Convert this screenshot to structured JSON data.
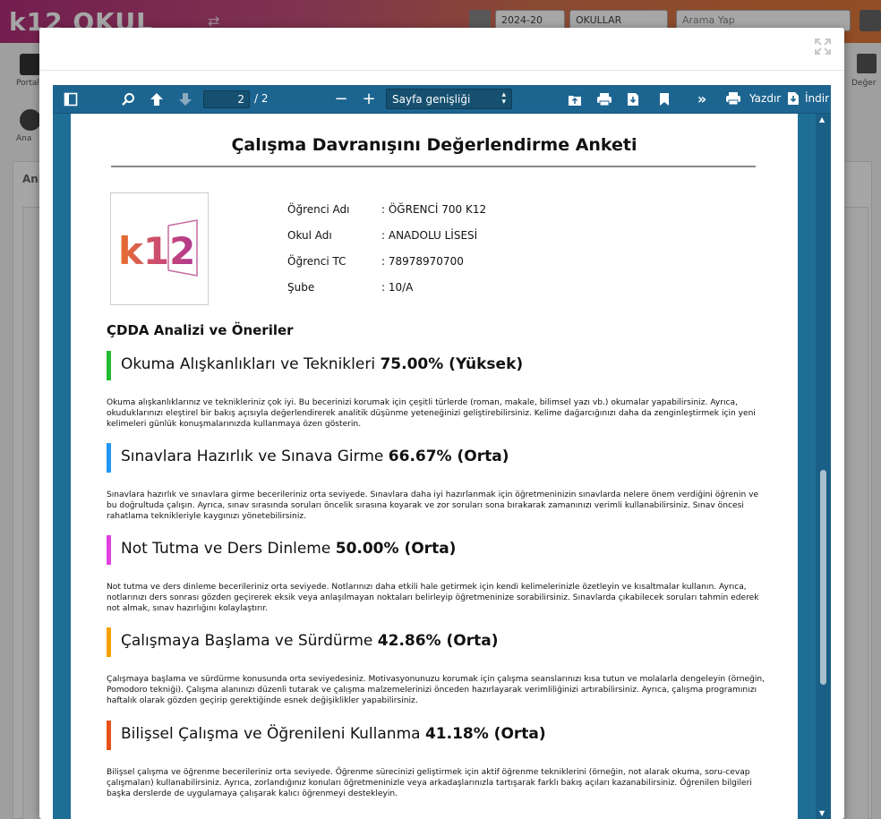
{
  "app": {
    "logo": "k12 OKUL",
    "year_select": "2024-20",
    "class_select": "OKULLAR",
    "search_placeholder": "Arama Yap",
    "side_label_1": "Portal",
    "side_label_2": "Ana",
    "right_label": "Değer",
    "panel_tab": "Ank"
  },
  "viewer": {
    "page_current": "2",
    "page_total": "/ 2",
    "zoom": "Sayfa genişliği",
    "print_label": "Yazdır",
    "download_label": "İndir"
  },
  "document": {
    "title": "Çalışma Davranışını Değerlendirme Anketi",
    "logo_text": "k12",
    "info": [
      {
        "label": "Öğrenci Adı",
        "value": ": ÖĞRENCİ 700 K12"
      },
      {
        "label": "Okul Adı",
        "value": ": ANADOLU LİSESİ"
      },
      {
        "label": "Öğrenci TC",
        "value": ": 78978970700"
      },
      {
        "label": "Şube",
        "value": ": 10/A"
      }
    ],
    "section_heading": "ÇDDA Analizi ve Öneriler",
    "items": [
      {
        "color": "#22bb33",
        "name": "Okuma Alışkanlıkları ve Teknikleri",
        "score": "75.00% (Yüksek)",
        "text": "Okuma alışkanlıklarınız ve teknikleriniz çok iyi. Bu becerinizi korumak için çeşitli türlerde (roman, makale, bilimsel yazı vb.) okumalar yapabilirsiniz. Ayrıca, okuduklarınızı eleştirel bir bakış açısıyla değerlendirerek analitik düşünme yeteneğinizi geliştirebilirsiniz. Kelime dağarcığınızı daha da zenginleştirmek için yeni kelimeleri günlük konuşmalarınızda kullanmaya özen gösterin."
      },
      {
        "color": "#2196f3",
        "name": "Sınavlara Hazırlık ve Sınava Girme",
        "score": "66.67% (Orta)",
        "text": "Sınavlara hazırlık ve sınavlara girme becerileriniz orta seviyede. Sınavlara daha iyi hazırlanmak için öğretmeninizin sınavlarda nelere önem verdiğini öğrenin ve bu doğrultuda çalışın. Ayrıca, sınav sırasında soruları öncelik sırasına koyarak ve zor soruları sona bırakarak zamanınızı verimli kullanabilirsiniz. Sınav öncesi rahatlama teknikleriyle kaygınızı yönetebilirsiniz."
      },
      {
        "color": "#e040e0",
        "name": "Not Tutma ve Ders Dinleme",
        "score": "50.00% (Orta)",
        "text": "Not tutma ve ders dinleme becerileriniz orta seviyede. Notlarınızı daha etkili hale getirmek için kendi kelimelerinizle özetleyin ve kısaltmalar kullanın. Ayrıca, notlarınızı ders sonrası gözden geçirerek eksik veya anlaşılmayan noktaları belirleyip öğretmeninize sorabilirsiniz. Sınavlarda çıkabilecek soruları tahmin ederek not almak, sınav hazırlığını kolaylaştırır."
      },
      {
        "color": "#f5a000",
        "name": "Çalışmaya Başlama ve Sürdürme",
        "score": "42.86% (Orta)",
        "text": "Çalışmaya başlama ve sürdürme konusunda orta seviyedesiniz. Motivasyonunuzu korumak için çalışma seanslarınızı kısa tutun ve molalarla dengeleyin (örneğin, Pomodoro tekniği). Çalışma alanınızı düzenli tutarak ve çalışma malzemelerinizi önceden hazırlayarak verimliliğinizi artırabilirsiniz. Ayrıca, çalışma programınızı haftalık olarak gözden geçirip gerektiğinde esnek değişiklikler yapabilirsiniz."
      },
      {
        "color": "#e8501a",
        "name": "Bilişsel Çalışma ve Öğrenileni Kullanma",
        "score": "41.18% (Orta)",
        "text": "Bilişsel çalışma ve öğrenme becerileriniz orta seviyede. Öğrenme sürecinizi geliştirmek için aktif öğrenme tekniklerini (örneğin, not alarak okuma, soru-cevap çalışmaları) kullanabilirsiniz. Ayrıca, zorlandığınız konuları öğretmeninizle veya arkadaşlarınızla tartışarak farklı bakış açıları kazanabilirsiniz. Öğrenilen bilgileri başka derslerde de uygulamaya çalışarak kalıcı öğrenmeyi destekleyin."
      }
    ]
  }
}
